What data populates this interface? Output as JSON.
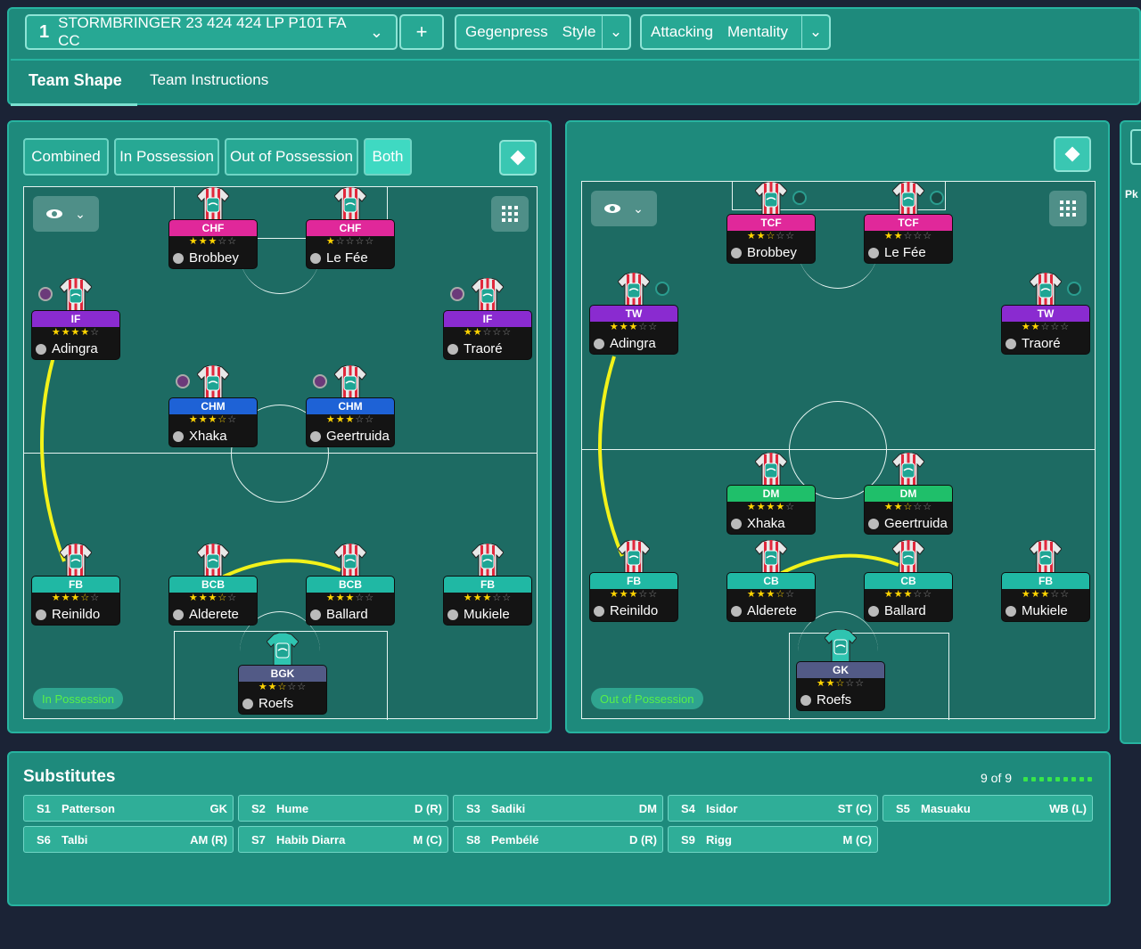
{
  "header": {
    "tactic_number": "1",
    "tactic_name": "STORMBRINGER 23 424 424 LP P101 FA CC",
    "add_label": "+",
    "style_value": "Gegenpress",
    "style_label": "Style",
    "mentality_value": "Attacking",
    "mentality_label": "Mentality"
  },
  "tabs": [
    {
      "label": "Team Shape"
    },
    {
      "label": "Team Instructions"
    }
  ],
  "view_modes": [
    "Combined",
    "In Possession",
    "Out of Possession",
    "Both"
  ],
  "left_pitch": {
    "label": "In Possession",
    "players": [
      {
        "role": "CHF",
        "stars": 3,
        "half": false,
        "name": "Brobbey",
        "color": "#e0289a",
        "badge": false
      },
      {
        "role": "CHF",
        "stars": 1,
        "half": false,
        "name": "Le Fée",
        "color": "#e0289a",
        "badge": false
      },
      {
        "role": "IF",
        "stars": 4,
        "half": false,
        "name": "Adingra",
        "color": "#8a2bd0",
        "badge": true
      },
      {
        "role": "IF",
        "stars": 2,
        "half": false,
        "name": "Traoré",
        "color": "#8a2bd0",
        "badge": true
      },
      {
        "role": "CHM",
        "stars": 3,
        "half": true,
        "name": "Xhaka",
        "color": "#1e62d6",
        "badge": true
      },
      {
        "role": "CHM",
        "stars": 3,
        "half": false,
        "name": "Geertruida",
        "color": "#1e62d6",
        "badge": true
      },
      {
        "role": "FB",
        "stars": 3,
        "half": true,
        "name": "Reinildo",
        "color": "#20b8a4",
        "badge": false
      },
      {
        "role": "BCB",
        "stars": 3,
        "half": true,
        "name": "Alderete",
        "color": "#20b8a4",
        "badge": false
      },
      {
        "role": "BCB",
        "stars": 3,
        "half": false,
        "name": "Ballard",
        "color": "#20b8a4",
        "badge": false
      },
      {
        "role": "FB",
        "stars": 3,
        "half": false,
        "name": "Mukiele",
        "color": "#20b8a4",
        "badge": false
      },
      {
        "role": "BGK",
        "stars": 2,
        "half": true,
        "name": "Roefs",
        "color": "#525a86",
        "badge": false
      }
    ]
  },
  "right_pitch": {
    "label": "Out of Possession",
    "players": [
      {
        "role": "TCF",
        "stars": 2,
        "half": true,
        "name": "Brobbey",
        "color": "#e0289a",
        "badge": true
      },
      {
        "role": "TCF",
        "stars": 2,
        "half": false,
        "name": "Le Fée",
        "color": "#e0289a",
        "badge": true
      },
      {
        "role": "TW",
        "stars": 3,
        "half": false,
        "name": "Adingra",
        "color": "#8a2bd0",
        "badge": true
      },
      {
        "role": "TW",
        "stars": 2,
        "half": false,
        "name": "Traoré",
        "color": "#8a2bd0",
        "badge": true
      },
      {
        "role": "DM",
        "stars": 4,
        "half": false,
        "name": "Xhaka",
        "color": "#1fbf6a",
        "badge": false
      },
      {
        "role": "DM",
        "stars": 2,
        "half": true,
        "name": "Geertruida",
        "color": "#1fbf6a",
        "badge": false
      },
      {
        "role": "FB",
        "stars": 3,
        "half": false,
        "name": "Reinildo",
        "color": "#20b8a4",
        "badge": false
      },
      {
        "role": "CB",
        "stars": 3,
        "half": true,
        "name": "Alderete",
        "color": "#20b8a4",
        "badge": false
      },
      {
        "role": "CB",
        "stars": 3,
        "half": false,
        "name": "Ballard",
        "color": "#20b8a4",
        "badge": false
      },
      {
        "role": "FB",
        "stars": 3,
        "half": false,
        "name": "Mukiele",
        "color": "#20b8a4",
        "badge": false
      },
      {
        "role": "GK",
        "stars": 2,
        "half": true,
        "name": "Roefs",
        "color": "#525a86",
        "badge": false
      }
    ]
  },
  "substitutes": {
    "title": "Substitutes",
    "count": "9 of 9",
    "filled": 9,
    "items": [
      {
        "slot": "S1",
        "name": "Patterson",
        "pos": "GK"
      },
      {
        "slot": "S2",
        "name": "Hume",
        "pos": "D (R)"
      },
      {
        "slot": "S3",
        "name": "Sadiki",
        "pos": "DM"
      },
      {
        "slot": "S4",
        "name": "Isidor",
        "pos": "ST (C)"
      },
      {
        "slot": "S5",
        "name": "Masuaku",
        "pos": "WB (L)"
      },
      {
        "slot": "S6",
        "name": "Talbi",
        "pos": "AM (R)"
      },
      {
        "slot": "S7",
        "name": "Habib Diarra",
        "pos": "M (C)"
      },
      {
        "slot": "S8",
        "name": "Pembélé",
        "pos": "D (R)"
      },
      {
        "slot": "S9",
        "name": "Rigg",
        "pos": "M (C)"
      }
    ]
  },
  "edge_label": "Pk",
  "colors": {
    "accent": "#27b3a0",
    "panel": "#1e8a7c",
    "pitch": "#1d6b63",
    "link_line": "#f2f21a",
    "star": "#ffd400"
  }
}
